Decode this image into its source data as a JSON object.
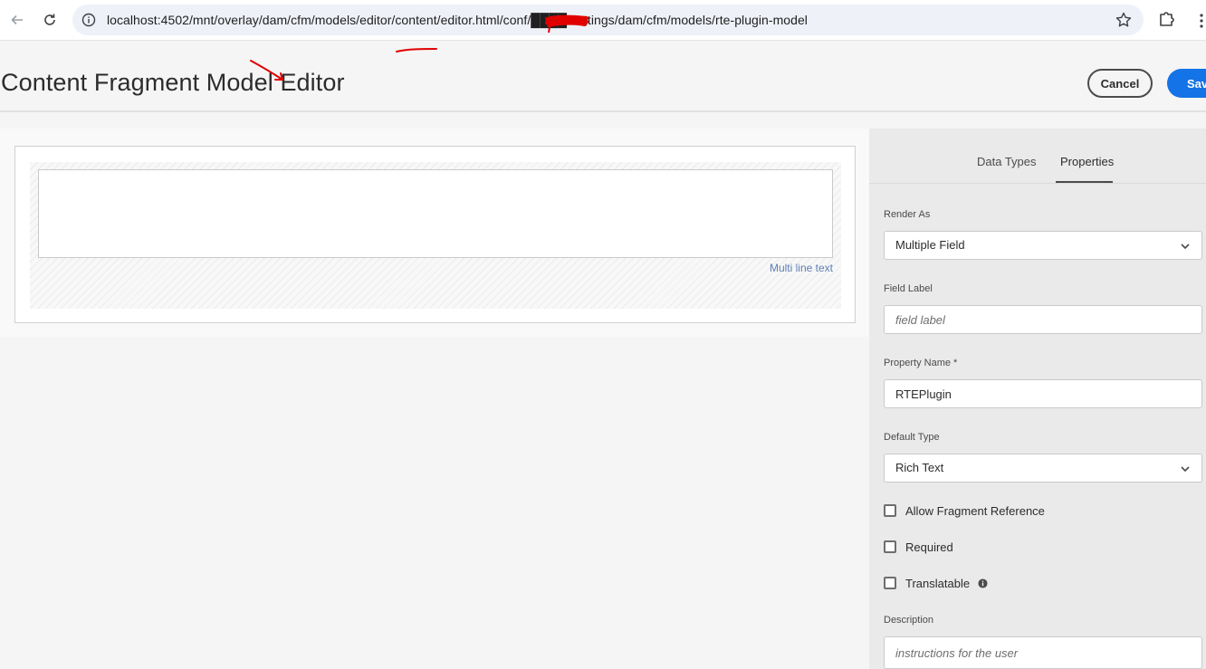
{
  "browser": {
    "url": "localhost:4502/mnt/overlay/dam/cfm/models/editor/content/editor.html/conf/████/settings/dam/cfm/models/rte-plugin-model",
    "icons": [
      "back-arrow-icon",
      "reload-icon",
      "info-icon",
      "star-icon",
      "extensions-icon",
      "menu-dots-icon"
    ]
  },
  "header": {
    "title": "Content Fragment Model Editor",
    "cancel_label": "Cancel",
    "save_label": "Save"
  },
  "canvas": {
    "field_type_label": "Multi line text"
  },
  "panel": {
    "tabs": [
      {
        "label": "Data Types",
        "active": false
      },
      {
        "label": "Properties",
        "active": true
      }
    ],
    "render_as": {
      "label": "Render As",
      "value": "Multiple Field"
    },
    "field_label": {
      "label": "Field Label",
      "placeholder": "field label",
      "value": ""
    },
    "property_name": {
      "label": "Property Name *",
      "value": "RTEPlugin"
    },
    "default_type": {
      "label": "Default Type",
      "value": "Rich Text"
    },
    "checkboxes": [
      {
        "label": "Allow Fragment Reference",
        "checked": false
      },
      {
        "label": "Required",
        "checked": false
      },
      {
        "label": "Translatable",
        "checked": false
      }
    ],
    "description": {
      "label": "Description",
      "placeholder": "instructions for the user",
      "value": ""
    }
  },
  "colors": {
    "accent": "#1473e6",
    "annotation": "#e00000"
  }
}
